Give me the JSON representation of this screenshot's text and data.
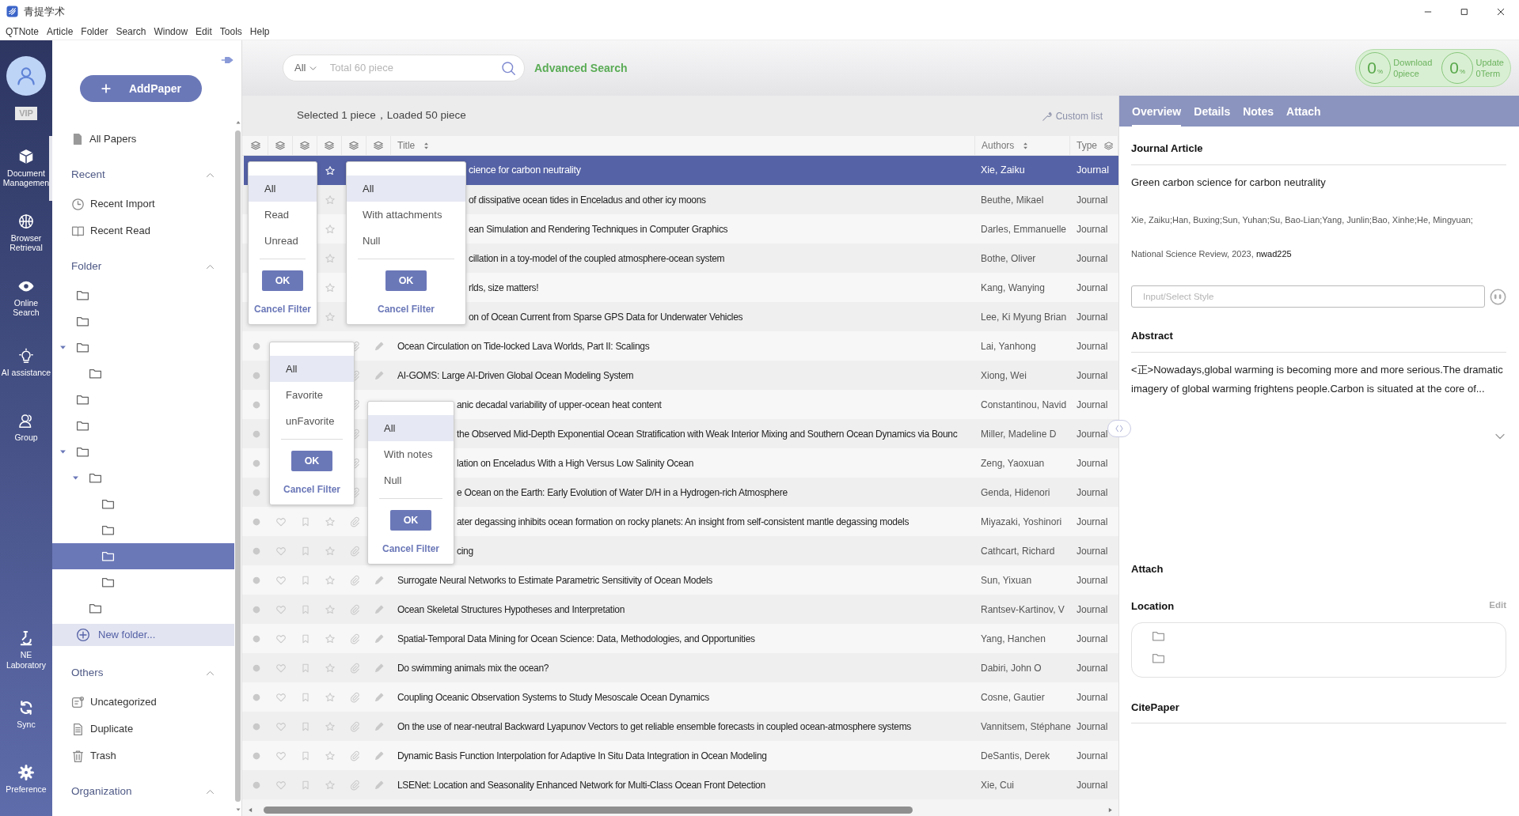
{
  "window": {
    "title": "青提学术"
  },
  "menu": [
    "QTNote",
    "Article",
    "Folder",
    "Search",
    "Window",
    "Edit",
    "Tools",
    "Help"
  ],
  "nav": {
    "vip": "VIP",
    "items": [
      {
        "kind": "docs",
        "label": "Document Managemen",
        "selected": true
      },
      {
        "kind": "browser",
        "label": "Browser Retrieval",
        "selected": false
      },
      {
        "kind": "online",
        "label": "Online Search",
        "selected": false
      },
      {
        "kind": "ai",
        "label": "AI assistance",
        "selected": false
      },
      {
        "kind": "group",
        "label": "Group",
        "selected": false
      }
    ],
    "bottom_items": [
      {
        "kind": "lab",
        "label": "NE Laboratory",
        "selected": false
      },
      {
        "kind": "sync",
        "label": "Sync",
        "selected": false
      },
      {
        "kind": "preference",
        "label": "Preference",
        "selected": false
      }
    ]
  },
  "sidebar": {
    "add_button": "AddPaper",
    "all_papers": "All Papers",
    "sections": [
      {
        "kind": "list",
        "title": "Recent",
        "expanded": true,
        "items": [
          {
            "kind": "clock",
            "label": "Recent Import"
          },
          {
            "kind": "book",
            "label": "Recent Read"
          }
        ]
      },
      {
        "kind": "folders",
        "title": "Folder",
        "expanded": true,
        "new_folder": "New folder...",
        "folders": [
          {
            "selected": false
          },
          {
            "selected": false
          },
          {
            "selected": false,
            "expanded": true,
            "children": [
              {
                "selected": false
              }
            ]
          },
          {
            "selected": false
          },
          {
            "selected": false
          },
          {
            "selected": false,
            "expanded": true,
            "children": [
              {
                "selected": false,
                "expanded": true,
                "children": [
                  {
                    "selected": false
                  },
                  {
                    "selected": false
                  },
                  {
                    "selected": true
                  },
                  {
                    "selected": false
                  }
                ]
              },
              {
                "selected": false
              }
            ]
          }
        ]
      },
      {
        "kind": "list",
        "title": "Others",
        "expanded": true,
        "items": [
          {
            "kind": "uncategorized",
            "label": "Uncategorized"
          },
          {
            "kind": "duplicate",
            "label": "Duplicate"
          },
          {
            "kind": "trash",
            "label": "Trash"
          }
        ]
      },
      {
        "kind": "list",
        "title": "Organization",
        "expanded": true
      }
    ]
  },
  "search": {
    "scope": "All",
    "placeholder": "Total 60 piece"
  },
  "advanced_search": "Advanced Search",
  "progress": [
    {
      "value": "0",
      "unit": "%",
      "label": "Download",
      "count": "0piece"
    },
    {
      "value": "0",
      "unit": "%",
      "label": "Update",
      "count": "0Term"
    }
  ],
  "status": "Selected 1 piece，Loaded 50 piece",
  "custom_list": "Custom list",
  "table": {
    "columns": [
      "Title",
      "Authors",
      "Type"
    ],
    "rows": [
      {
        "title": "cience for carbon neutrality",
        "authors": "Xie, Zaiku",
        "type": "Journal",
        "selected": true
      },
      {
        "title": "of dissipative ocean tides in Enceladus and other icy moons",
        "authors": "Beuthe, Mikael",
        "type": "Journal",
        "selected": false
      },
      {
        "title": "ean Simulation and Rendering Techniques in Computer Graphics",
        "authors": "Darles, Emmanuelle",
        "type": "Journal",
        "selected": false
      },
      {
        "title": "cillation in a toy-model of the coupled atmosphere-ocean system",
        "authors": "Bothe, Oliver",
        "type": "Journal",
        "selected": false
      },
      {
        "title": "rlds, size matters!",
        "authors": "Kang, Wanying",
        "type": "Journal",
        "selected": false
      },
      {
        "title": "on of Ocean Current from Sparse GPS Data for Underwater Vehicles",
        "authors": "Lee, Ki Myung Brian",
        "type": "Journal",
        "selected": false
      },
      {
        "title": "Ocean Circulation on Tide-locked Lava Worlds, Part II: Scalings",
        "authors": "Lai, Yanhong",
        "type": "Journal",
        "selected": false
      },
      {
        "title": "AI-GOMS: Large AI-Driven Global Ocean Modeling System",
        "authors": "Xiong, Wei",
        "type": "Journal",
        "selected": false
      },
      {
        "title": "anic decadal variability of upper-ocean heat content",
        "authors": "Constantinou, Navid",
        "type": "Journal",
        "selected": false
      },
      {
        "title": "the Observed Mid-Depth Exponential Ocean Stratification with Weak Interior Mixing and Southern Ocean Dynamics via Bounc",
        "authors": "Miller, Madeline D",
        "type": "Journal",
        "selected": false
      },
      {
        "title": "lation on Enceladus With a High Versus Low Salinity Ocean",
        "authors": "Zeng, Yaoxuan",
        "type": "Journal",
        "selected": false
      },
      {
        "title": "e Ocean on the Earth: Early Evolution of Water D/H in a Hydrogen-rich Atmosphere",
        "authors": "Genda, Hidenori",
        "type": "Journal",
        "selected": false
      },
      {
        "title": "ater degassing inhibits ocean formation on rocky planets: An insight from self-consistent mantle degassing models",
        "authors": "Miyazaki, Yoshinori",
        "type": "Journal",
        "selected": false
      },
      {
        "title": "cing",
        "authors": "Cathcart, Richard",
        "type": "Journal",
        "selected": false
      },
      {
        "title": "Surrogate Neural Networks to Estimate Parametric Sensitivity of Ocean Models",
        "authors": "Sun, Yixuan",
        "type": "Journal",
        "selected": false
      },
      {
        "title": "Ocean Skeletal Structures Hypotheses and Interpretation",
        "authors": "Rantsev-Kartinov, V",
        "type": "Journal",
        "selected": false
      },
      {
        "title": "Spatial-Temporal Data Mining for Ocean Science: Data, Methodologies, and Opportunities",
        "authors": "Yang, Hanchen",
        "type": "Journal",
        "selected": false
      },
      {
        "title": "Do swimming animals mix the ocean?",
        "authors": "Dabiri, John O",
        "type": "Journal",
        "selected": false
      },
      {
        "title": "Coupling Oceanic Observation Systems to Study Mesoscale Ocean Dynamics",
        "authors": "Cosne, Gautier",
        "type": "Journal",
        "selected": false
      },
      {
        "title": "On the use of near-neutral Backward Lyapunov Vectors to get reliable ensemble forecasts in coupled ocean-atmosphere systems",
        "authors": "Vannitsem, Stéphane",
        "type": "Journal",
        "selected": false
      },
      {
        "title": "Dynamic Basis Function Interpolation for Adaptive In Situ Data Integration in Ocean Modeling",
        "authors": "DeSantis, Derek",
        "type": "Journal",
        "selected": false
      },
      {
        "title": "LSENet: Location and Seasonality Enhanced Network for Multi-Class Ocean Front Detection",
        "authors": "Xie, Cui",
        "type": "Journal",
        "selected": false
      }
    ]
  },
  "filter_popups": [
    {
      "options": [
        {
          "label": "All",
          "selected": true
        },
        {
          "label": "Read",
          "selected": false
        },
        {
          "label": "Unread",
          "selected": false
        }
      ],
      "ok": "OK",
      "cancel": "Cancel Filter"
    },
    {
      "options": [
        {
          "label": "All",
          "selected": true
        },
        {
          "label": "With attachments",
          "selected": false
        },
        {
          "label": "Null",
          "selected": false
        }
      ],
      "ok": "OK",
      "cancel": "Cancel Filter"
    },
    {
      "options": [
        {
          "label": "All",
          "selected": true
        },
        {
          "label": "Favorite",
          "selected": false
        },
        {
          "label": "unFavorite",
          "selected": false
        }
      ],
      "ok": "OK",
      "cancel": "Cancel Filter"
    },
    {
      "options": [
        {
          "label": "All",
          "selected": true
        },
        {
          "label": "With notes",
          "selected": false
        },
        {
          "label": "Null",
          "selected": false
        }
      ],
      "ok": "OK",
      "cancel": "Cancel Filter"
    }
  ],
  "detail_tabs": [
    {
      "label": "Overview",
      "selected": true
    },
    {
      "label": "Details",
      "selected": false
    },
    {
      "label": "Notes",
      "selected": false
    },
    {
      "label": "Attach",
      "selected": false
    }
  ],
  "overview": {
    "type": "Journal Article",
    "title": "Green carbon science for carbon neutrality",
    "authors": "Xie, Zaiku;Han, Buxing;Sun, Yuhan;Su, Bao-Lian;Yang, Junlin;Bao, Xinhe;He, Mingyuan;",
    "source": "National Science Review, 2023,",
    "id": "nwad225",
    "style_placeholder": "Input/Select Style",
    "abstract_heading": "Abstract",
    "abstract": "<正>Nowadays,global warming is becoming more and more serious.The dramatic imagery of global warming frightens people.Carbon is situated at the core of...",
    "attach_heading": "Attach",
    "location_heading": "Location",
    "edit": "Edit",
    "cite_heading": "CitePaper"
  }
}
